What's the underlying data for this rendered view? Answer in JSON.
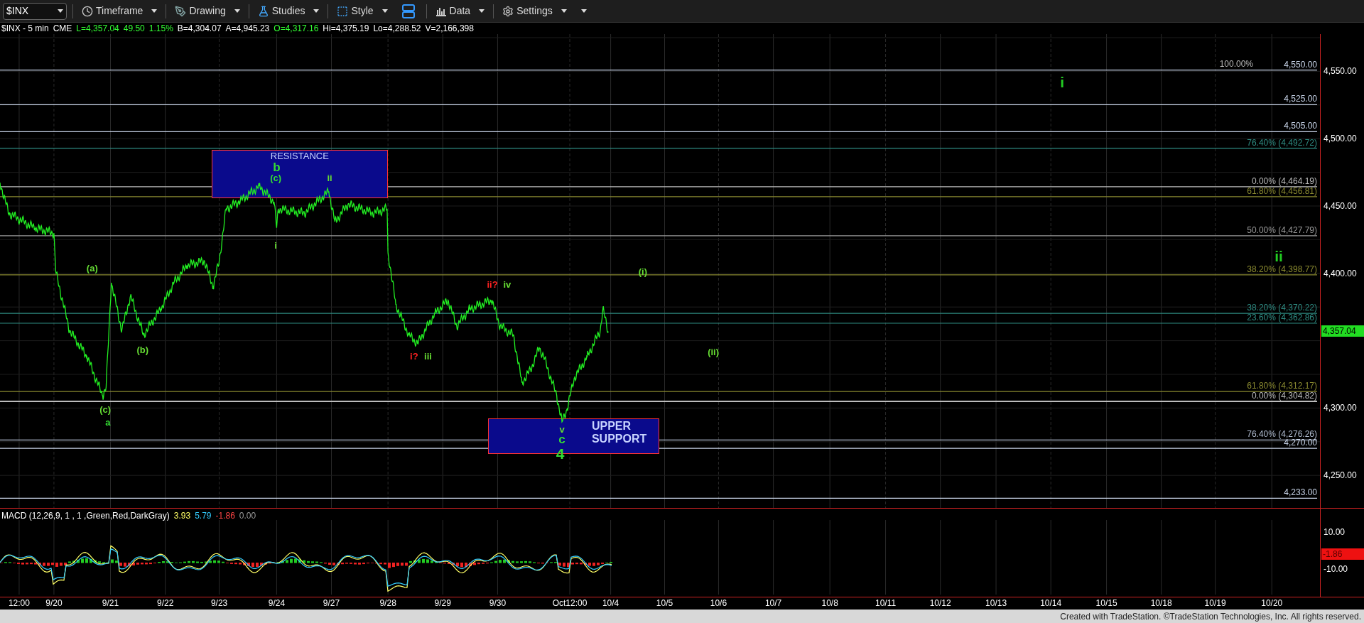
{
  "toolbar": {
    "symbol": "$INX",
    "menus": [
      {
        "label": "Timeframe"
      },
      {
        "label": "Drawing"
      },
      {
        "label": "Studies"
      },
      {
        "label": "Style"
      },
      {
        "label": "Data"
      },
      {
        "label": "Settings"
      }
    ]
  },
  "quote": [
    {
      "text": "$INX - 5 min",
      "color": "#ffffff"
    },
    {
      "text": "CME",
      "color": "#ffffff"
    },
    {
      "text": "L=4,357.04",
      "color": "#33ff33"
    },
    {
      "text": "49.50",
      "color": "#33ff33"
    },
    {
      "text": "1.15%",
      "color": "#33ff33"
    },
    {
      "text": "B=4,304.07",
      "color": "#ffffff"
    },
    {
      "text": "A=4,945.23",
      "color": "#ffffff"
    },
    {
      "text": "O=4,317.16",
      "color": "#33ff33"
    },
    {
      "text": "Hi=4,375.19",
      "color": "#ffffff"
    },
    {
      "text": "Lo=4,288.52",
      "color": "#ffffff"
    },
    {
      "text": "V=2,166,398",
      "color": "#ffffff"
    }
  ],
  "levels": [
    {
      "label": "100.00%",
      "color": "#bbbbbb"
    },
    {
      "label": "4,550.00",
      "color": "#c8d4e8"
    },
    {
      "label": "4,525.00",
      "color": "#c8d4e8"
    },
    {
      "label": "4,505.00",
      "color": "#c8d4e8"
    },
    {
      "label": "76.40% (4,492.72)",
      "color": "#2e8b82"
    },
    {
      "label": "0.00% (4,464.19)",
      "color": "#bbbbbb"
    },
    {
      "label": "61.80% (4,456.81)",
      "color": "#8a8a30"
    },
    {
      "label": "50.00% (4,427.79)",
      "color": "#999999"
    },
    {
      "label": "38.20% (4,398.77)",
      "color": "#8a8a30"
    },
    {
      "label": "38.20% (4,370.22)",
      "color": "#2e8b82"
    },
    {
      "label": "23.60% (4,362.86)",
      "color": "#2e8b82"
    },
    {
      "label": "61.80% (4,312.17)",
      "color": "#8a8a30"
    },
    {
      "label": "0.00% (4,304.82)",
      "color": "#bbbbbb"
    },
    {
      "label": "76.40% (4,276.26)",
      "color": "#b0bcd0"
    },
    {
      "label": "4,270.00",
      "color": "#c8d4e8"
    },
    {
      "label": "4,233.00",
      "color": "#c8d4e8"
    }
  ],
  "zones": [
    {
      "lines": [
        "RESISTANCE"
      ],
      "kind": "resistance"
    },
    {
      "lines": [
        "UPPER",
        "SUPPORT"
      ],
      "kind": "support"
    }
  ],
  "waves": [
    {
      "text": "b",
      "color": "#33dd33",
      "kind": "major"
    },
    {
      "text": "(c)",
      "color": "#33dd33",
      "kind": "minor"
    },
    {
      "text": "ii",
      "color": "#66dd33",
      "kind": "minor"
    },
    {
      "text": "i",
      "color": "#66dd33",
      "kind": "minor"
    },
    {
      "text": "(a)",
      "color": "#66dd33",
      "kind": "minor"
    },
    {
      "text": "(b)",
      "color": "#66dd33",
      "kind": "minor"
    },
    {
      "text": "(c)",
      "color": "#66dd33",
      "kind": "minor"
    },
    {
      "text": "a",
      "color": "#33dd33",
      "kind": "minor"
    },
    {
      "text": "(i)",
      "color": "#66dd33",
      "kind": "minor"
    },
    {
      "text": "ii?",
      "color": "#ff2222",
      "kind": "minor"
    },
    {
      "text": "iv",
      "color": "#66dd33",
      "kind": "minor"
    },
    {
      "text": "i?",
      "color": "#ff2222",
      "kind": "minor"
    },
    {
      "text": "iii",
      "color": "#66dd33",
      "kind": "minor"
    },
    {
      "text": "(ii)",
      "color": "#66dd33",
      "kind": "minor"
    },
    {
      "text": "v",
      "color": "#66dd33",
      "kind": "minor"
    },
    {
      "text": "c",
      "color": "#33dd33",
      "kind": "major"
    },
    {
      "text": "4",
      "color": "#33dd33",
      "kind": "big"
    },
    {
      "text": "i",
      "color": "#22cc22",
      "kind": "big"
    },
    {
      "text": "ii",
      "color": "#22cc22",
      "kind": "big"
    }
  ],
  "price_axis": [
    "4,550.00",
    "4,500.00",
    "4,450.00",
    "4,400.00",
    "4,300.00",
    "4,250.00"
  ],
  "current_price": "4,357.04",
  "macd": {
    "title": "MACD (12,26,9, 1 , 1 ,Green,Red,DarkGray)",
    "values": [
      {
        "text": "3.93",
        "color": "#ffff66"
      },
      {
        "text": "5.79",
        "color": "#33ccff"
      },
      {
        "text": "-1.86",
        "color": "#ff4444"
      },
      {
        "text": "0.00",
        "color": "#999999"
      }
    ],
    "axis": [
      "10.00",
      "-10.00"
    ],
    "current": "-1.86"
  },
  "dates": [
    "12:00",
    "9/20",
    "9/21",
    "9/22",
    "9/23",
    "9/24",
    "9/27",
    "9/28",
    "9/29",
    "9/30",
    "Oct12:00",
    "10/4",
    "10/5",
    "10/6",
    "10/7",
    "10/8",
    "10/11",
    "10/12",
    "10/13",
    "10/14",
    "10/15",
    "10/18",
    "10/19",
    "10/20"
  ],
  "footer": "Created with TradeStation. ©TradeStation Technologies, Inc. All rights reserved."
}
